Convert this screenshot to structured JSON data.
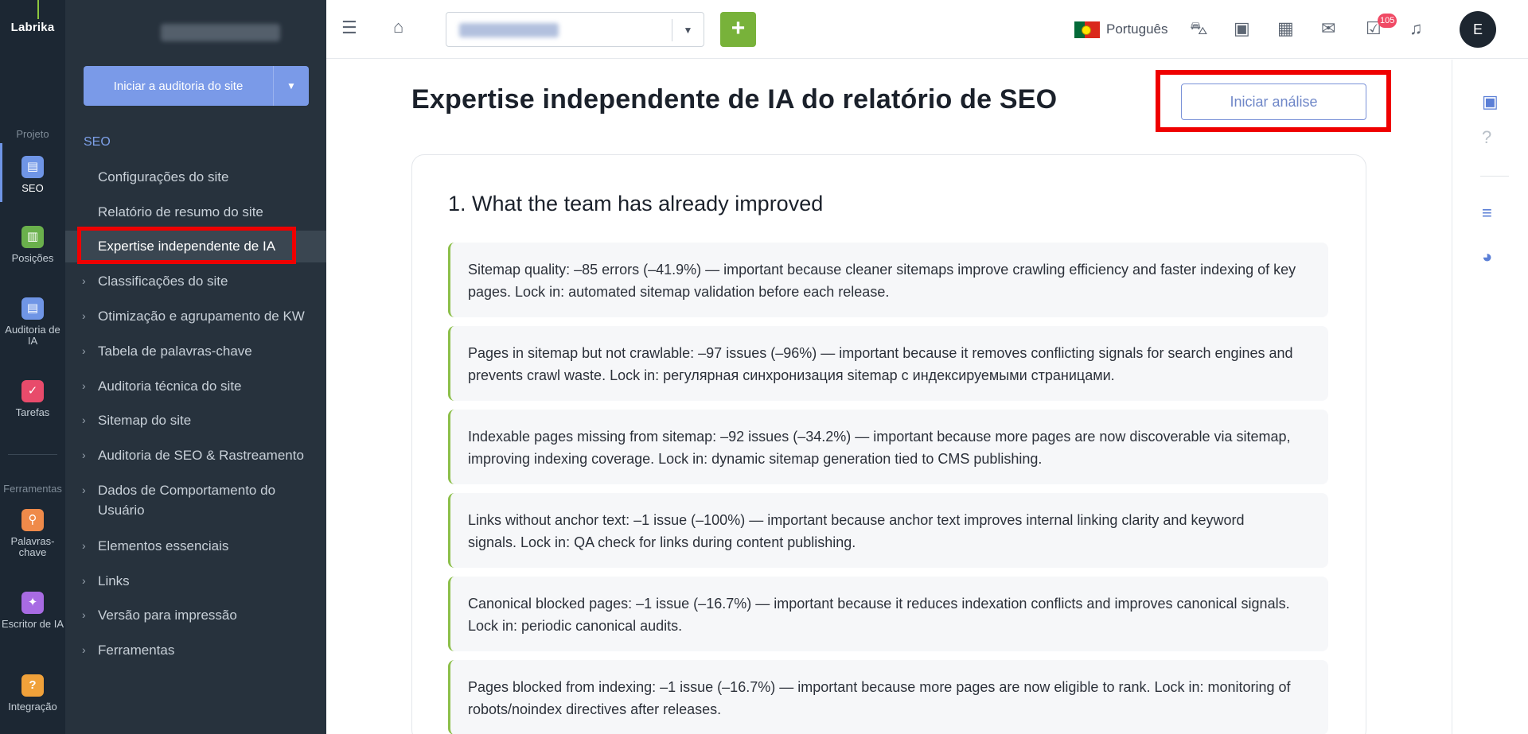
{
  "app": {
    "logo": "Labrika"
  },
  "rail": {
    "section_project": "Projeto",
    "section_tools": "Ferramentas",
    "items": [
      {
        "label": "SEO",
        "icon": "clipboard-icon",
        "color": "#6f95e6"
      },
      {
        "label": "Posições",
        "icon": "chart-icon",
        "color": "#6ab04c"
      },
      {
        "label": "Auditoria de IA",
        "icon": "clipboard-icon",
        "color": "#6f95e6"
      },
      {
        "label": "Tarefas",
        "icon": "check-icon",
        "color": "#e84b6b"
      },
      {
        "label": "Palavras-chave",
        "icon": "key-icon",
        "color": "#ef8a4a"
      },
      {
        "label": "Escritor de IA",
        "icon": "magic-wand-icon",
        "color": "#a86be3"
      },
      {
        "label": "Integração",
        "icon": "help-circle-icon",
        "color": "#f0a13a"
      }
    ]
  },
  "menu": {
    "audit_button": "Iniciar a auditoria do site",
    "section": "SEO",
    "items": [
      {
        "label": "Configurações do site"
      },
      {
        "label": "Relatório de resumo do site"
      },
      {
        "label": "Expertise independente de IA"
      },
      {
        "label": "Classificações do site"
      },
      {
        "label": "Otimização e agrupamento de KW"
      },
      {
        "label": "Tabela de palavras-chave"
      },
      {
        "label": "Auditoria técnica do site"
      },
      {
        "label": "Sitemap do site"
      },
      {
        "label": "Auditoria de SEO & Rastreamento"
      },
      {
        "label": "Dados de Comportamento do Usuário"
      },
      {
        "label": "Elementos essenciais"
      },
      {
        "label": "Links"
      },
      {
        "label": "Versão para impressão"
      },
      {
        "label": "Ferramentas"
      }
    ]
  },
  "header": {
    "language": "Português",
    "notifications_count": "105",
    "avatar_initial": "E"
  },
  "main": {
    "title": "Expertise independente de IA do relatório de SEO",
    "start_button": "Iniciar análise",
    "card_heading": "1. What the team has already improved",
    "items": [
      {
        "line1": "Sitemap quality: –85 errors (–41.9%) — important because cleaner sitemaps improve crawling efficiency and faster indexing of key",
        "line2": "pages. Lock in: automated sitemap validation before each release."
      },
      {
        "line1": "Pages in sitemap but not crawlable: –97 issues (–96%) — important because it removes conflicting signals for search engines and",
        "line2": "prevents crawl waste. Lock in: регулярная синхронизация sitemap с индексируемыми страницами."
      },
      {
        "line1": "Indexable pages missing from sitemap: –92 issues (–34.2%) — important because more pages are now discoverable via sitemap,",
        "line2": "improving indexing coverage. Lock in: dynamic sitemap generation tied to CMS publishing."
      },
      {
        "line1": "Links without anchor text: –1 issue (–100%) — important because anchor text improves internal linking clarity and keyword",
        "line2": "signals. Lock in: QA check for links during content publishing."
      },
      {
        "line1": "Canonical blocked pages: –1 issue (–16.7%) — important because it reduces indexation conflicts and improves canonical signals.",
        "line2": "Lock in: periodic canonical audits."
      },
      {
        "line1": "Pages blocked from indexing: –1 issue (–16.7%) — important because more pages are now eligible to rank. Lock in: monitoring of",
        "line2": "robots/noindex directives after releases."
      }
    ]
  },
  "colors": {
    "accent": "#6f95e6",
    "add_green": "#78b23a",
    "highlight_red": "#ef0000",
    "item_border": "#8cbf4a"
  }
}
